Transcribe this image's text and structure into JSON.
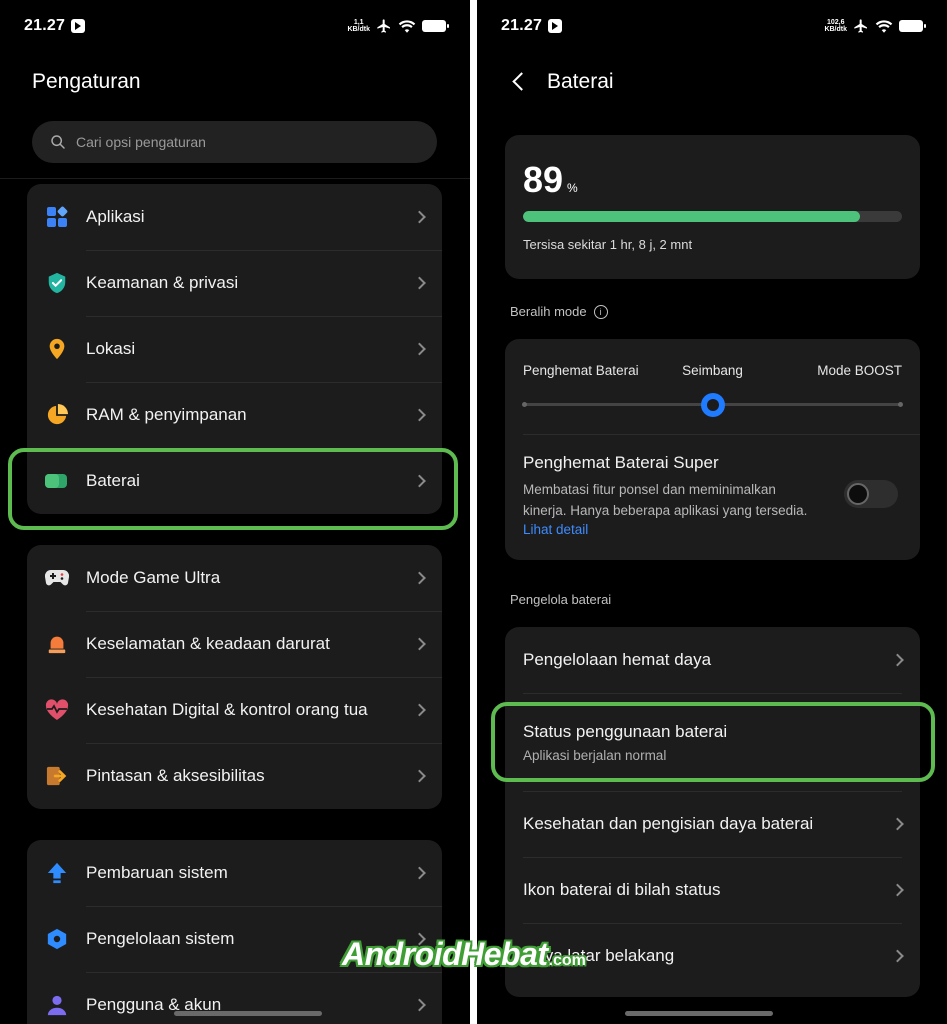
{
  "left_screen": {
    "status_bar": {
      "time": "21.27",
      "speed_value": "1,1",
      "speed_unit": "KB/dtk"
    },
    "title": "Pengaturan",
    "search": {
      "placeholder": "Cari opsi pengaturan"
    },
    "groups": [
      {
        "items": [
          {
            "label": "Aplikasi",
            "icon": "apps-icon"
          },
          {
            "label": "Keamanan & privasi",
            "icon": "shield-icon"
          },
          {
            "label": "Lokasi",
            "icon": "location-pin-icon"
          },
          {
            "label": "RAM & penyimpanan",
            "icon": "pie-chart-icon"
          },
          {
            "label": "Baterai",
            "icon": "battery-icon",
            "highlighted": true
          }
        ]
      },
      {
        "items": [
          {
            "label": "Mode Game Ultra",
            "icon": "gamepad-icon"
          },
          {
            "label": "Keselamatan & keadaan darurat",
            "icon": "siren-icon"
          },
          {
            "label": "Kesehatan Digital & kontrol orang tua",
            "icon": "heart-pulse-icon"
          },
          {
            "label": "Pintasan & aksesibilitas",
            "icon": "shortcut-icon"
          }
        ]
      },
      {
        "items": [
          {
            "label": "Pembaruan sistem",
            "icon": "update-arrow-icon"
          },
          {
            "label": "Pengelolaan sistem",
            "icon": "system-hexagon-icon"
          },
          {
            "label": "Pengguna & akun",
            "icon": "user-icon"
          }
        ]
      }
    ]
  },
  "right_screen": {
    "status_bar": {
      "time": "21.27",
      "speed_value": "102,6",
      "speed_unit": "KB/dtk"
    },
    "title": "Baterai",
    "battery": {
      "percent": "89",
      "percent_sign": "%",
      "level": 0.89,
      "remaining": "Tersisa sekitar 1 hr, 8 j, 2 mnt"
    },
    "mode_section": {
      "label": "Beralih mode",
      "info_glyph": "i",
      "options": [
        "Penghemat Baterai",
        "Seimbang",
        "Mode BOOST"
      ],
      "selected_index": 1
    },
    "super_saver": {
      "title": "Penghemat Baterai Super",
      "description": "Membatasi fitur ponsel dan meminimalkan kinerja. Hanya beberapa aplikasi yang tersedia.",
      "link": "Lihat detail",
      "enabled": false
    },
    "manager_section": {
      "label": "Pengelola baterai",
      "items": [
        {
          "title": "Pengelolaan hemat daya",
          "subtitle": ""
        },
        {
          "title": "Status penggunaan baterai",
          "subtitle": "Aplikasi berjalan normal",
          "highlighted": true
        },
        {
          "title": "Kesehatan dan pengisian daya baterai",
          "subtitle": ""
        },
        {
          "title": "Ikon baterai di bilah status",
          "subtitle": ""
        },
        {
          "title": "Daya latar belakang",
          "subtitle": ""
        }
      ]
    }
  },
  "watermark": {
    "main": "AndroidHebat",
    "suffix": ".com"
  },
  "colors": {
    "highlight": "#5dbb4f",
    "battery_fill": "#4cc27a",
    "accent_blue": "#1f7bff",
    "link": "#3d8bff"
  }
}
